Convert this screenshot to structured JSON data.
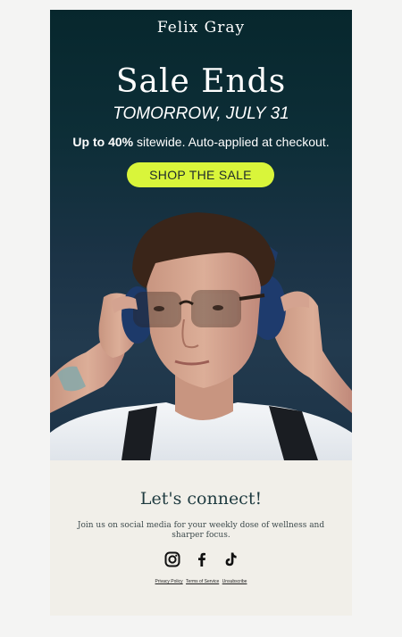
{
  "brand": {
    "name": "Felix Gray"
  },
  "hero": {
    "headline": "Sale Ends",
    "subheadline": "TOMORROW, JULY 31",
    "offer_bold": "Up to 40%",
    "offer_rest": " sitewide. Auto-applied at checkout.",
    "cta_label": "SHOP THE SALE",
    "cta_color": "#d9f53a",
    "background_color": "#0b2c32"
  },
  "footer": {
    "title": "Let's connect!",
    "text": "Join us on social media for your weekly dose of wellness and sharper focus.",
    "social_icons": [
      "instagram-icon",
      "facebook-icon",
      "tiktok-icon"
    ],
    "links": [
      "Privacy Policy",
      "Terms of Service",
      "Unsubscribe"
    ]
  }
}
